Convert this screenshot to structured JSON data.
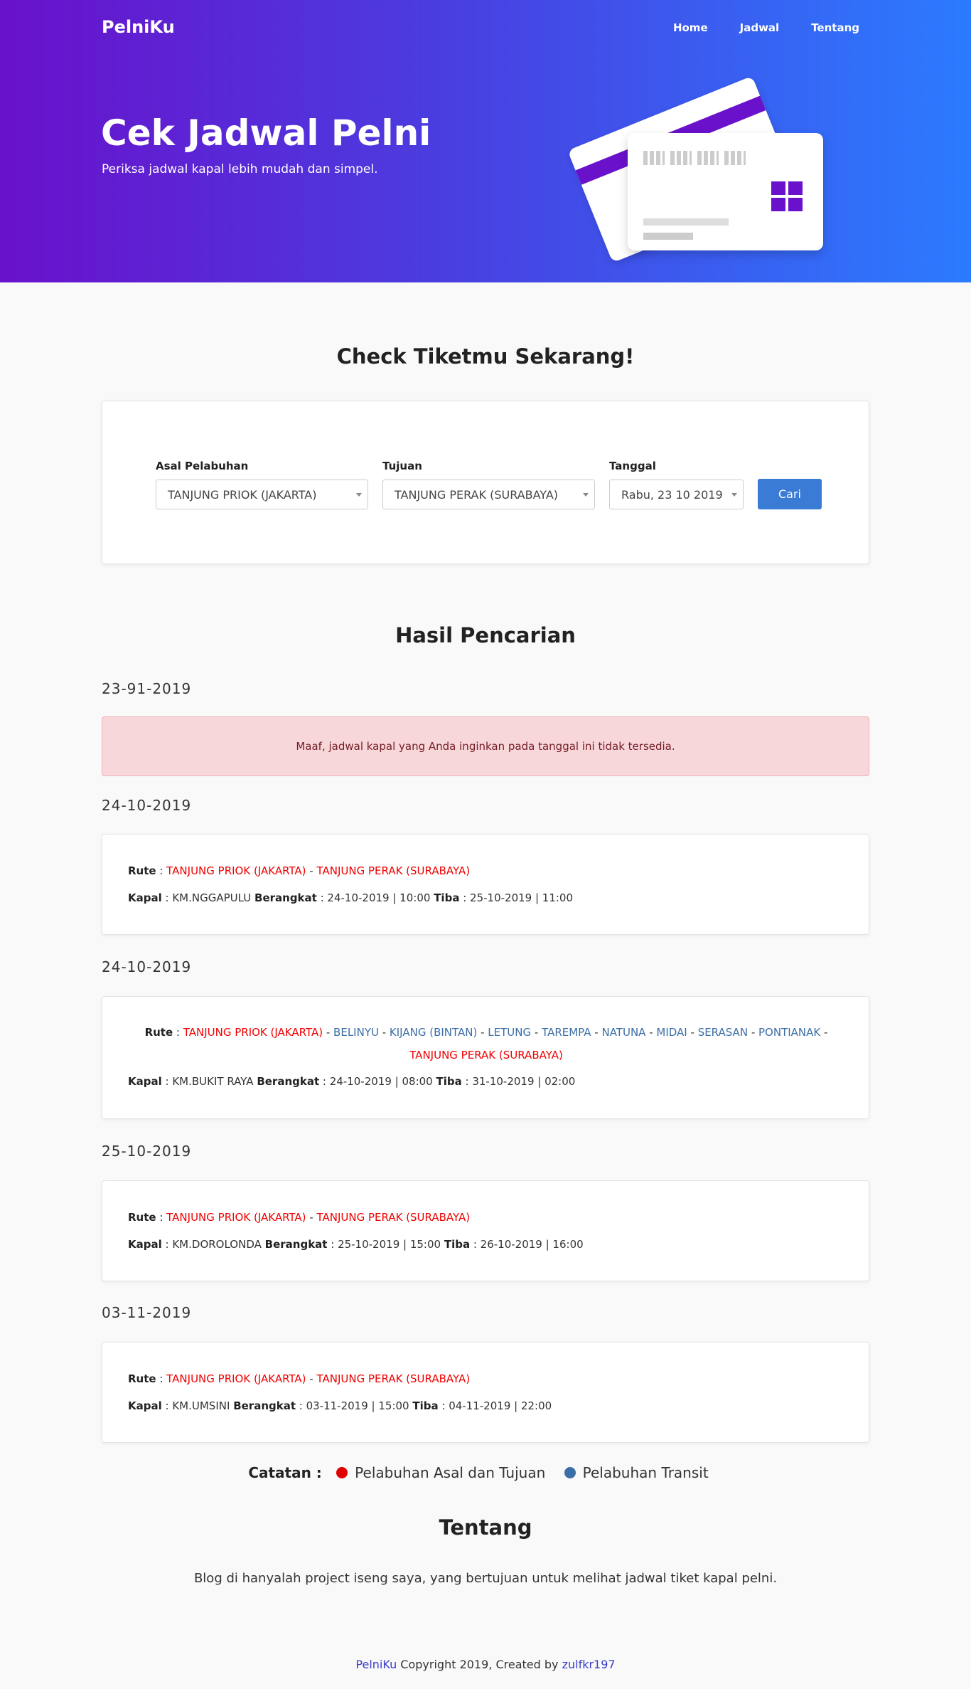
{
  "header": {
    "brand": "PelniKu",
    "nav": [
      "Home",
      "Jadwal",
      "Tentang"
    ],
    "title": "Cek Jadwal Pelni",
    "subtitle": "Periksa jadwal kapal lebih mudah dan simpel."
  },
  "check": {
    "title": "Check Tiketmu Sekarang!",
    "asal_label": "Asal Pelabuhan",
    "asal_value": "TANJUNG PRIOK (JAKARTA)",
    "tujuan_label": "Tujuan",
    "tujuan_value": "TANJUNG PERAK (SURABAYA)",
    "tanggal_label": "Tanggal",
    "tanggal_value": "Rabu, 23 10 2019",
    "button": "Cari"
  },
  "results": {
    "title": "Hasil Pencarian",
    "labels": {
      "rute": "Rute",
      "kapal": "Kapal",
      "berangkat": "Berangkat",
      "tiba": "Tiba"
    },
    "empty_date": "23-91-2019",
    "empty_message": "Maaf, jadwal kapal yang Anda inginkan pada tanggal ini tidak tersedia.",
    "items": [
      {
        "date": "24-10-2019",
        "origin": "TANJUNG PRIOK (JAKARTA)",
        "destination": "TANJUNG PERAK (SURABAYA)",
        "kapal": "KM.NGGAPULU",
        "berangkat": "24-10-2019 | 10:00",
        "tiba": "25-10-2019 | 11:00"
      },
      {
        "date": "24-10-2019",
        "origin": "TANJUNG PRIOK (JAKARTA)",
        "destination": "TANJUNG PERAK (SURABAYA)",
        "transits": [
          "BELINYU",
          "KIJANG (BINTAN)",
          "LETUNG",
          "TAREMPA",
          "NATUNA",
          "MIDAI",
          "SERASAN",
          "PONTIANAK"
        ],
        "kapal": "KM.BUKIT RAYA",
        "berangkat": "24-10-2019 | 08:00",
        "tiba": "31-10-2019 | 02:00"
      },
      {
        "date": "25-10-2019",
        "origin": "TANJUNG PRIOK (JAKARTA)",
        "destination": "TANJUNG PERAK (SURABAYA)",
        "kapal": "KM.DOROLONDA",
        "berangkat": "25-10-2019 | 15:00",
        "tiba": "26-10-2019 | 16:00"
      },
      {
        "date": "03-11-2019",
        "origin": "TANJUNG PRIOK (JAKARTA)",
        "destination": "TANJUNG PERAK (SURABAYA)",
        "kapal": "KM.UMSINI",
        "berangkat": "03-11-2019 | 15:00",
        "tiba": "04-11-2019 | 22:00"
      }
    ]
  },
  "legend": {
    "label": "Catatan :",
    "asal": "Pelabuhan Asal dan Tujuan",
    "transit": "Pelabuhan Transit",
    "asal_color": "#e00000",
    "transit_color": "#3a6ea5"
  },
  "about": {
    "title": "Tentang",
    "text": "Blog di hanyalah project iseng saya, yang bertujuan untuk melihat jadwal tiket kapal pelni."
  },
  "footer": {
    "brand": "PelniKu",
    "middle": " Copyright 2019, Created by ",
    "author": "zulfkr197"
  },
  "colors": {
    "gradient_start": "#6a11cb",
    "gradient_end": "#2b7bff",
    "button": "#3a7bd5"
  }
}
